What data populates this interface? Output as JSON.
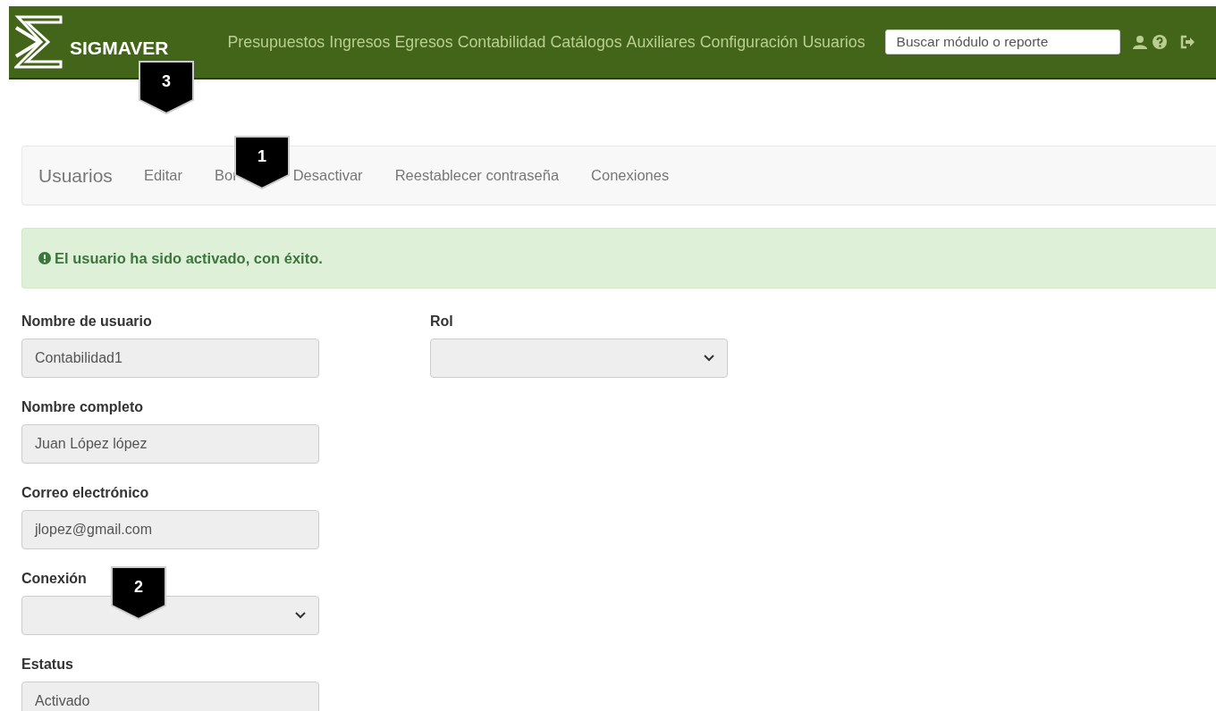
{
  "header": {
    "brand": "SIGMAVER",
    "menu": [
      "Presupuestos",
      "Ingresos",
      "Egresos",
      "Contabilidad",
      "Catálogos",
      "Auxiliares",
      "Configuración",
      "Usuarios"
    ],
    "search": {
      "placeholder": "Buscar módulo o reporte"
    }
  },
  "subnav": {
    "title": "Usuarios",
    "items": [
      "Editar",
      "Bor",
      "Desactivar",
      "Reestablecer contraseña",
      "Conexiones"
    ]
  },
  "alert": {
    "message": "El usuario ha sido activado, con éxito."
  },
  "form": {
    "left": [
      {
        "label": "Nombre de usuario",
        "kind": "text",
        "value": "Contabilidad1"
      },
      {
        "label": "Nombre completo",
        "kind": "text",
        "value": "Juan López lópez"
      },
      {
        "label": "Correo electrónico",
        "kind": "text",
        "value": "jlopez@gmail.com"
      },
      {
        "label": "Conexión",
        "kind": "select"
      },
      {
        "label": "Estatus",
        "kind": "text",
        "value": "Activado"
      }
    ],
    "right": [
      {
        "label": "Rol",
        "kind": "select"
      }
    ]
  },
  "callouts": [
    {
      "number": "3"
    },
    {
      "number": "1"
    },
    {
      "number": "2"
    }
  ]
}
